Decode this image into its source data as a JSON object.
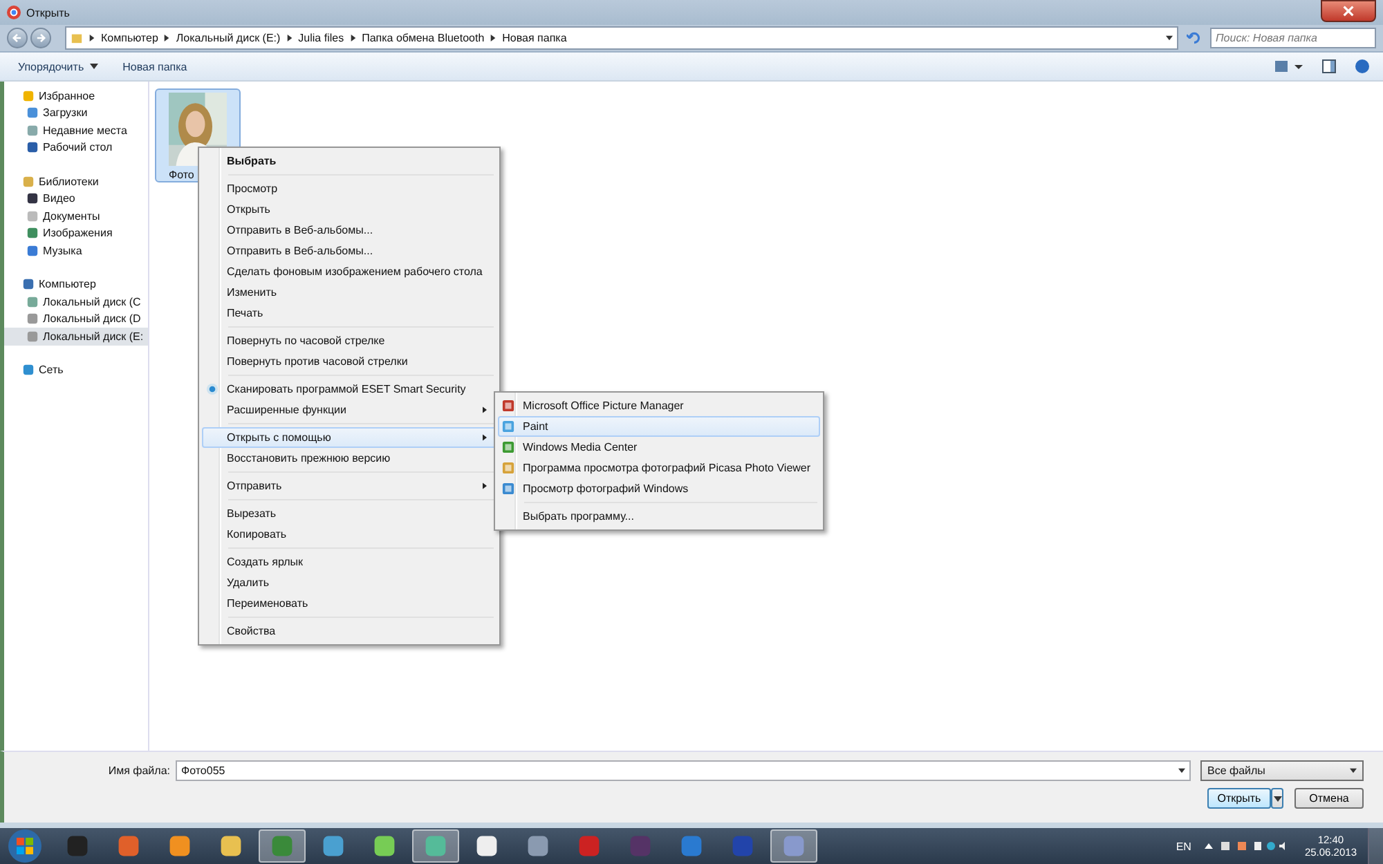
{
  "window": {
    "title": "Открыть"
  },
  "address": {
    "crumbs": [
      "Компьютер",
      "Локальный диск (E:)",
      "Julia files",
      "Папка обмена Bluetooth",
      "Новая папка"
    ],
    "search_placeholder": "Поиск: Новая папка"
  },
  "toolbar": {
    "organize": "Упорядочить",
    "new_folder": "Новая папка"
  },
  "sidebar": [
    {
      "label": "Избранное",
      "kind": "star",
      "selected": false,
      "children": [
        {
          "label": "Загрузки",
          "kind": "download",
          "selected": false
        },
        {
          "label": "Недавние места",
          "kind": "recent",
          "selected": false
        },
        {
          "label": "Рабочий стол",
          "kind": "desktop",
          "selected": false
        }
      ]
    },
    {
      "label": "Библиотеки",
      "kind": "library",
      "selected": false,
      "children": [
        {
          "label": "Видео",
          "kind": "video",
          "selected": false
        },
        {
          "label": "Документы",
          "kind": "document",
          "selected": false
        },
        {
          "label": "Изображения",
          "selected": false
        },
        {
          "label": "Музыка",
          "kind": "music",
          "selected": false
        }
      ]
    },
    {
      "label": "Компьютер",
      "kind": "computer",
      "selected": false,
      "children": [
        {
          "label": "Локальный диск (C",
          "kind": "system-drive",
          "selected": false
        },
        {
          "label": "Локальный диск (D",
          "kind": "drive",
          "selected": false
        },
        {
          "label": "Локальный диск (E:",
          "kind": "drive",
          "selected": true
        }
      ]
    },
    {
      "label": "Сеть",
      "kind": "network",
      "selected": false
    }
  ],
  "files": [
    {
      "name": "Фото",
      "kind": "picture",
      "selected": true
    }
  ],
  "context_menu": [
    [
      {
        "label": "Выбрать",
        "kind": "default",
        "selected": false
      }
    ],
    [
      {
        "label": "Просмотр",
        "kind": "command",
        "selected": false
      },
      {
        "label": "Открыть",
        "kind": "command",
        "selected": false
      },
      {
        "label": "Отправить в Веб-альбомы...",
        "kind": "command",
        "selected": false
      },
      {
        "label": "Отправить в Веб-альбомы...",
        "kind": "command",
        "selected": false
      },
      {
        "label": "Сделать фоновым изображением рабочего стола",
        "kind": "command",
        "selected": false
      },
      {
        "label": "Изменить",
        "kind": "command",
        "selected": false
      },
      {
        "label": "Печать",
        "kind": "command",
        "selected": false
      }
    ],
    [
      {
        "label": "Повернуть по часовой стрелке",
        "kind": "command",
        "selected": false
      },
      {
        "label": "Повернуть против часовой стрелки",
        "kind": "command",
        "selected": false
      }
    ],
    [
      {
        "label": "Сканировать программой ESET Smart Security",
        "kind": "icon",
        "selected": false
      },
      {
        "label": "Расширенные функции",
        "kind": "submenu",
        "selected": false
      }
    ],
    [
      {
        "label": "Открыть с помощью",
        "kind": "submenu",
        "selected": true
      },
      {
        "label": "Восстановить прежнюю версию",
        "kind": "command",
        "selected": false
      }
    ],
    [
      {
        "label": "Отправить",
        "kind": "submenu",
        "selected": false
      }
    ],
    [
      {
        "label": "Вырезать",
        "kind": "command",
        "selected": false
      },
      {
        "label": "Копировать",
        "kind": "command",
        "selected": false
      }
    ],
    [
      {
        "label": "Создать ярлык",
        "kind": "command",
        "selected": false
      },
      {
        "label": "Удалить",
        "kind": "command",
        "selected": false
      },
      {
        "label": "Переименовать",
        "kind": "command",
        "selected": false
      }
    ],
    [
      {
        "label": "Свойства",
        "kind": "command",
        "selected": false
      }
    ]
  ],
  "submenu": [
    [
      {
        "label": "Microsoft Office Picture Manager",
        "kind": "picture-manager",
        "selected": false
      },
      {
        "label": "Paint",
        "kind": "paint",
        "selected": true
      },
      {
        "label": "Windows Media Center",
        "kind": "media-center",
        "selected": false
      },
      {
        "label": "Программа просмотра фотографий Picasa Photo Viewer",
        "kind": "photo-viewer",
        "selected": false
      },
      {
        "label": "Просмотр фотографий Windows",
        "kind": "windows-photo",
        "selected": false
      }
    ],
    [
      {
        "label": "Выбрать программу...",
        "kind": "plain",
        "selected": false
      }
    ]
  ],
  "bottom": {
    "file_name_label": "Имя файла:",
    "file_name": "Фото055",
    "file_type": "Все файлы",
    "open": "Открыть",
    "cancel": "Отмена"
  },
  "taskbar": {
    "apps": [
      {
        "active": false
      },
      {
        "active": false
      },
      {
        "active": false
      },
      {
        "active": false
      },
      {
        "active": true
      },
      {
        "active": false
      },
      {
        "active": false
      },
      {
        "active": true
      },
      {
        "active": false
      },
      {
        "active": false
      },
      {
        "active": false
      },
      {
        "active": false
      },
      {
        "active": false
      },
      {
        "active": false
      },
      {
        "active": true
      }
    ],
    "language": "EN",
    "time": "12:40",
    "date": "25.06.2013"
  }
}
